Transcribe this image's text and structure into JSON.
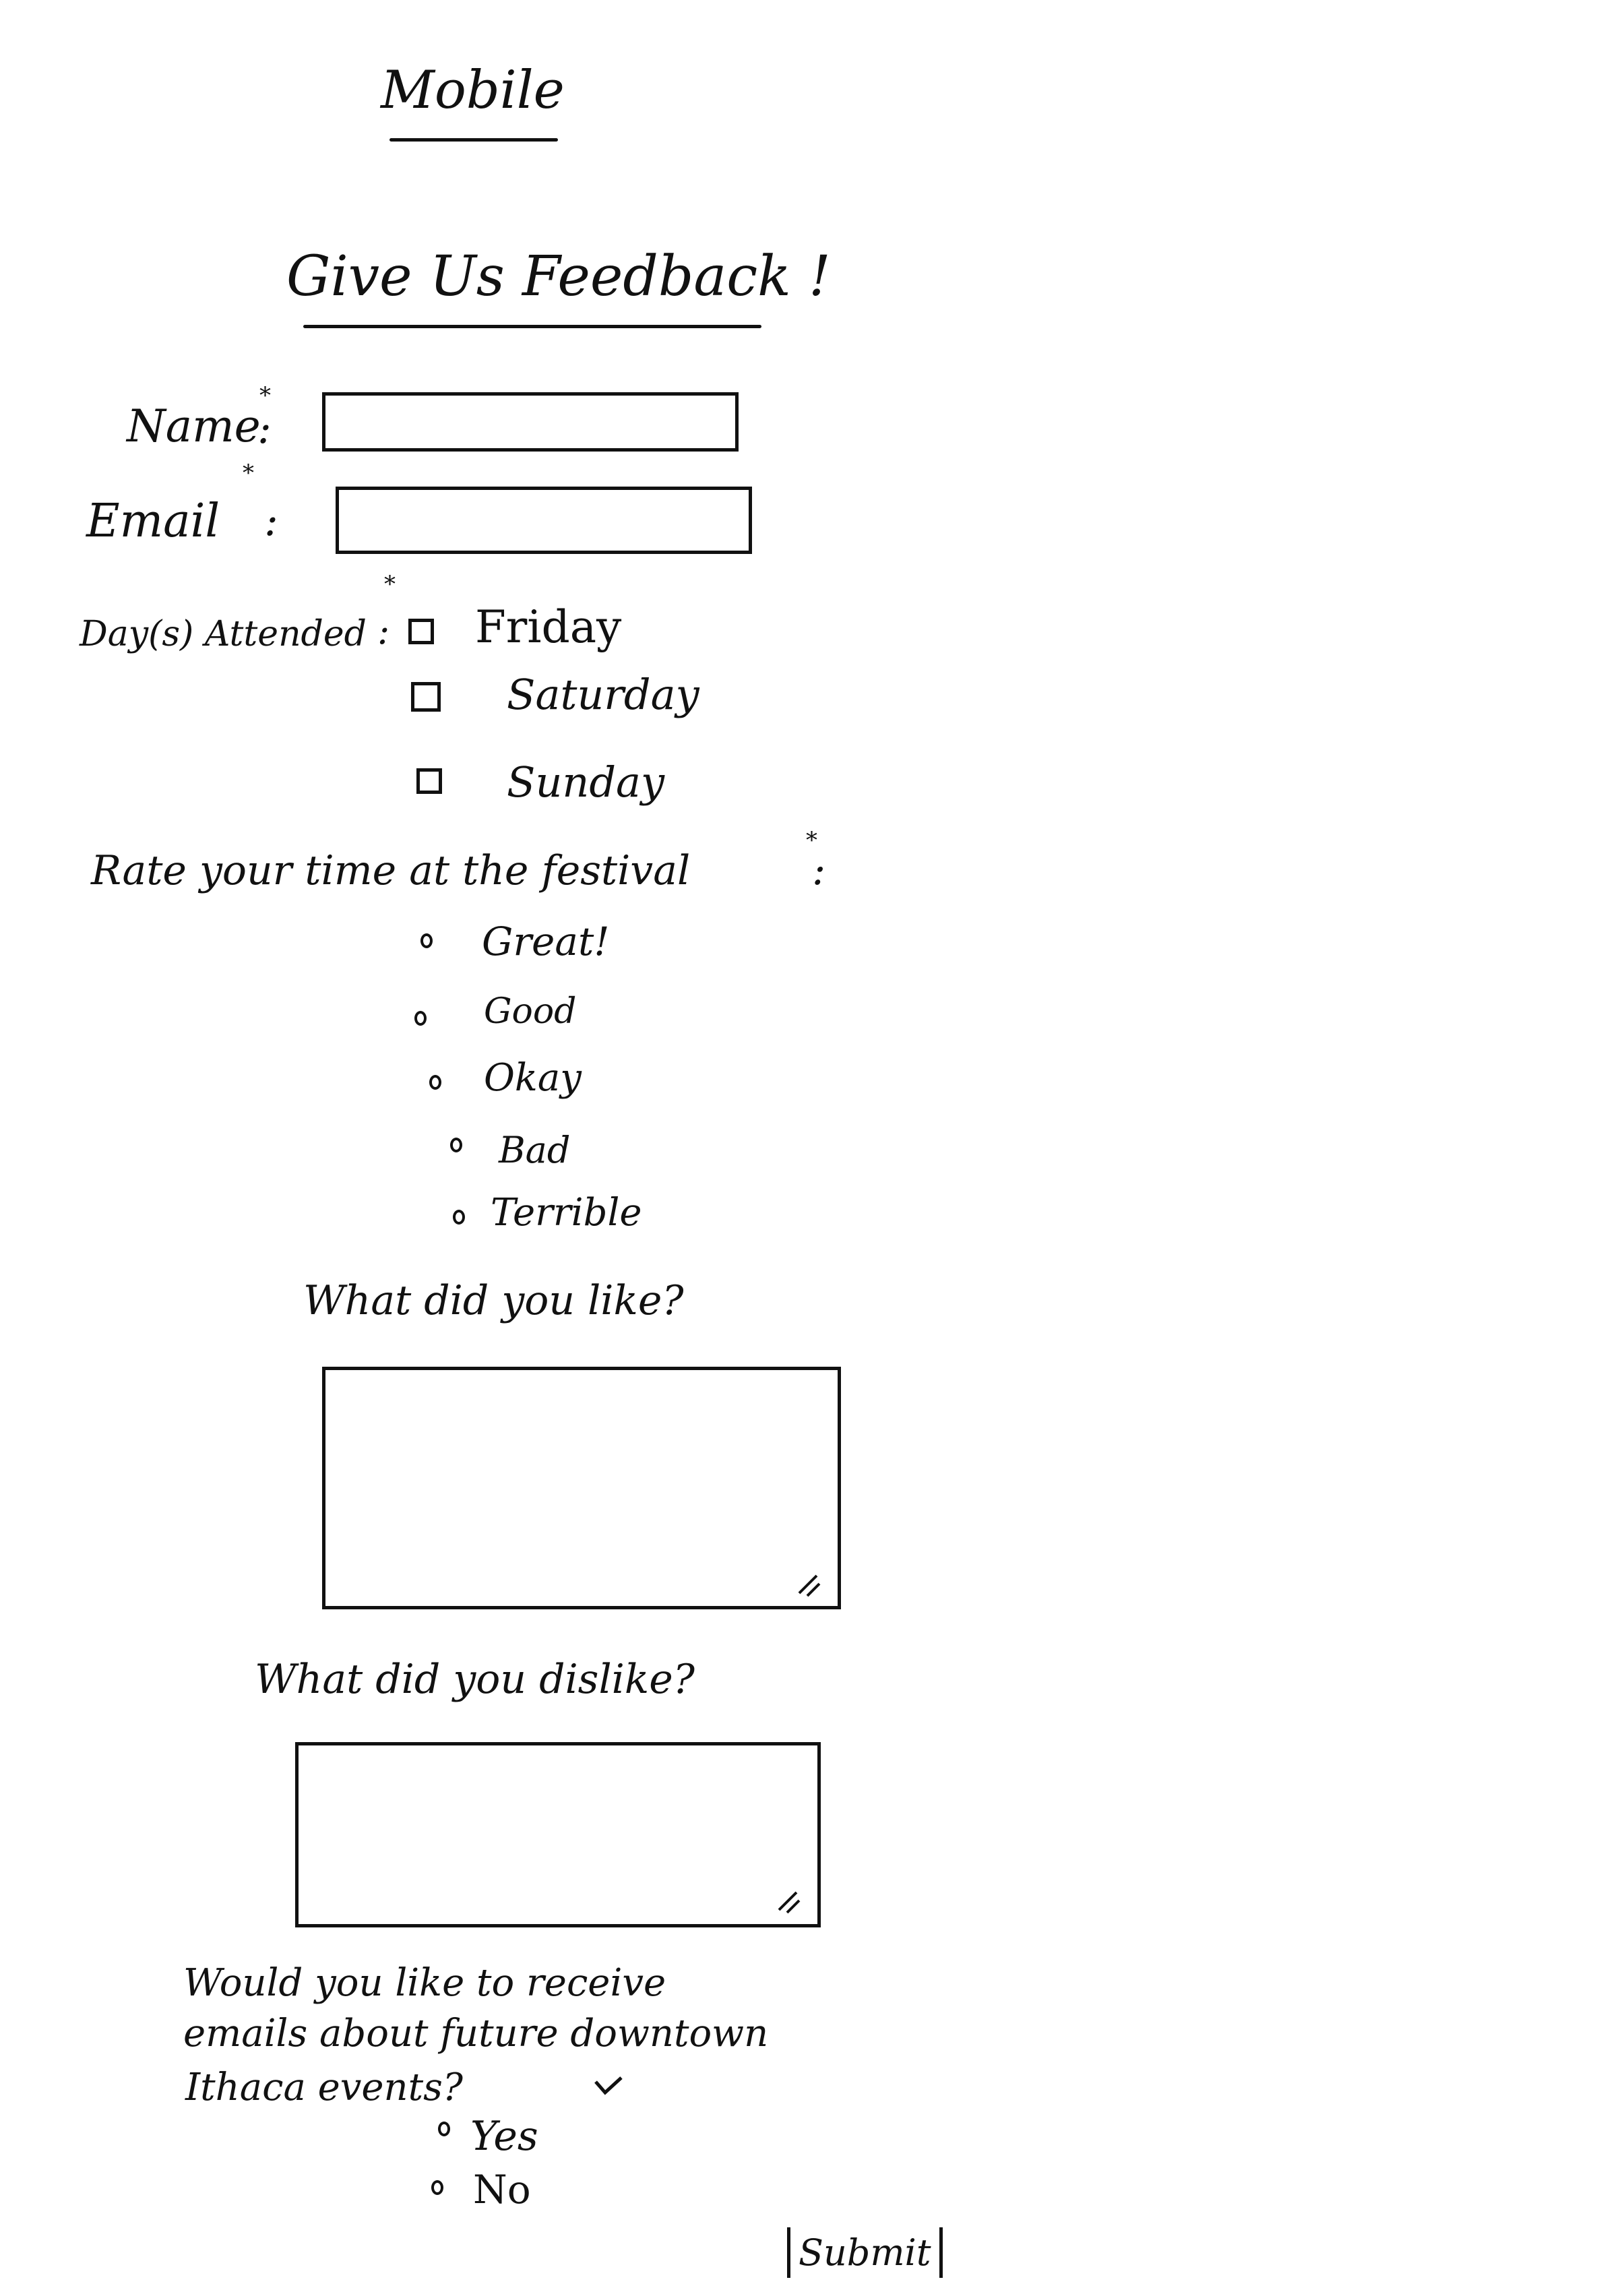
{
  "header": {
    "device_label": "Mobile"
  },
  "form": {
    "title": "Give Us Feedback !",
    "name_label": "Name",
    "email_label": "Email",
    "required_mark": "*",
    "colon": ":",
    "days_label": "Day(s) Attended",
    "days": [
      {
        "label": "Friday",
        "checked": false
      },
      {
        "label": "Saturday",
        "checked": false
      },
      {
        "label": "Sunday",
        "checked": false
      }
    ],
    "rating_label": "Rate your time at the festival",
    "ratings": [
      {
        "label": "Great!"
      },
      {
        "label": "Good"
      },
      {
        "label": "Okay"
      },
      {
        "label": "Bad"
      },
      {
        "label": "Terrible"
      }
    ],
    "liked_label": "What did you like?",
    "disliked_label": "What did you dislike?",
    "emails_question_line1": "Would you like to receive",
    "emails_question_line2": "emails about future downtown",
    "emails_question_line3": "Ithaca events?",
    "email_options": [
      {
        "label": "Yes"
      },
      {
        "label": "No"
      }
    ],
    "submit_label": "Submit"
  },
  "colors": {
    "ink": "#111111",
    "paper": "#ffffff"
  }
}
